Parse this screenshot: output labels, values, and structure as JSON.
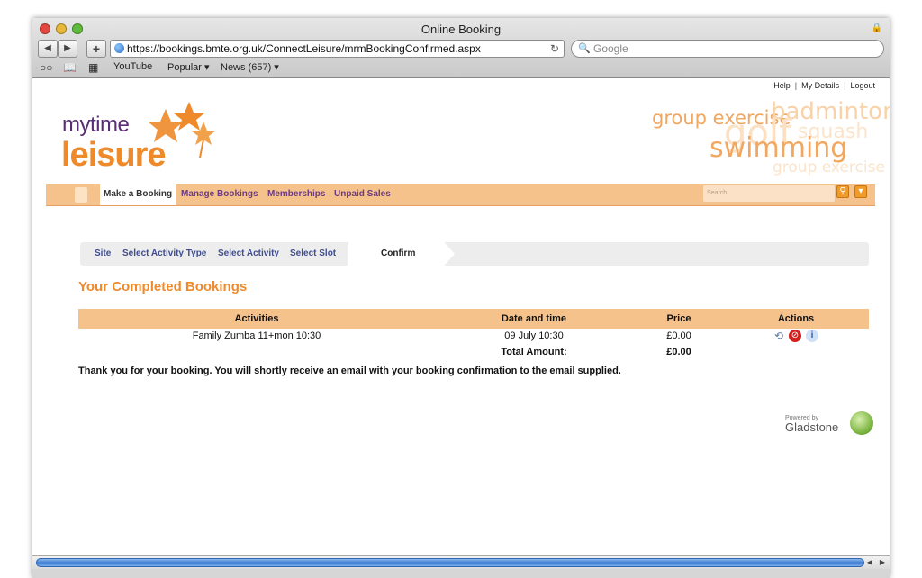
{
  "window": {
    "title": "Online Booking"
  },
  "toolbar": {
    "back_icon": "back-arrow-icon",
    "forward_icon": "forward-arrow-icon",
    "add_bookmark": "+",
    "url": "https://bookings.bmte.org.uk/ConnectLeisure/mrmBookingConfirmed.aspx",
    "search_placeholder": "Google"
  },
  "bookmarks": [
    {
      "label": "YouTube"
    },
    {
      "label": "Popular ▾"
    },
    {
      "label": "News (657) ▾"
    }
  ],
  "site": {
    "top_links": [
      "Help",
      "My Details",
      "Logout"
    ],
    "logo": {
      "line1": "mytime",
      "line2": "leisure"
    },
    "banner_words": [
      "group exercise",
      "badminton",
      "golf",
      "squash",
      "swimming",
      "group exercise"
    ],
    "menu": {
      "items": [
        "Make a Booking",
        "Manage Bookings",
        "Memberships",
        "Unpaid Sales"
      ],
      "active": "Make a Booking",
      "search_placeholder": "Search"
    },
    "breadcrumb": [
      "Site",
      "Select Activity Type",
      "Select Activity",
      "Select Slot",
      "Confirm"
    ],
    "heading": "Your Completed Bookings",
    "table": {
      "headers": [
        "Activities",
        "Date and time",
        "Price",
        "Actions"
      ],
      "rows": [
        {
          "activity": "Family Zumba 11+mon 10:30",
          "datetime": "09 July 10:30",
          "price": "£0.00"
        }
      ],
      "total_label": "Total Amount:",
      "total_value": "£0.00"
    },
    "message": "Thank you for your booking. You will shortly receive an email with your booking confirmation to the email supplied.",
    "powered": {
      "by": "Powered by",
      "brand": "Gladstone"
    }
  },
  "colors": {
    "accent": "#ee8a2a",
    "menu": "#f6c28c",
    "nav_link": "#6b3b80",
    "breadcrumb_link": "#3f4d8f"
  }
}
